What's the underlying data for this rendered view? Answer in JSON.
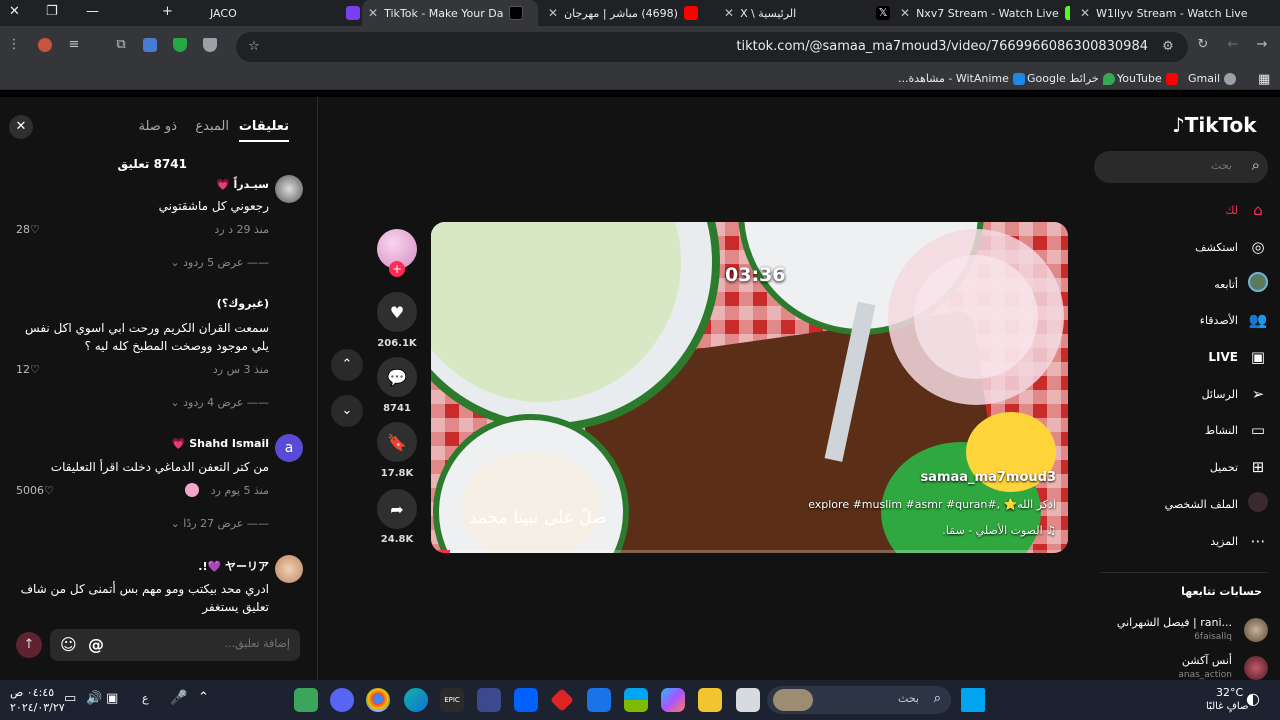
{
  "browser": {
    "tabs": [
      {
        "label": "JACO"
      },
      {
        "label": "TikTok - Make Your Da"
      },
      {
        "label": "(4698) مباشر | مهرجان"
      },
      {
        "label": "الرئيسية \\ X"
      },
      {
        "label": "Nxv7 Stream - Watch Live"
      },
      {
        "label": "W1llyv Stream - Watch Live"
      }
    ],
    "url": "tiktok.com/@samaa_ma7moud3/video/7669966086300830984",
    "bookmarks": [
      {
        "label": "WitAnime - مشاهدة..."
      },
      {
        "label": "خرائط Google"
      },
      {
        "label": "YouTube"
      },
      {
        "label": "Gmail"
      }
    ]
  },
  "comments_panel": {
    "tabs": [
      {
        "label": "تعليقات"
      },
      {
        "label": "المبدع"
      },
      {
        "label": "ذو صلة"
      }
    ],
    "count_label": "8741 تعليق",
    "input_placeholder": "إضافة تعليق...",
    "items": [
      {
        "user": "سيـدراً 💗",
        "text": "رجعوني كل ماشقتوني",
        "meta": "منذ 29 د    رد",
        "likes": "28",
        "replies": "عرض 5 ردود"
      },
      {
        "user": "(غيروك؟)",
        "text": "سمعت القران الكريم ورحت ابي اسوي اكل نفس يلي موجود ووصخت المطبخ كله ليه ؟",
        "meta": "منذ 3 س    رد",
        "likes": "12",
        "replies": "عرض 4 ردود"
      },
      {
        "user": "Shahd Ismail 💗",
        "text": "من كتر التعفن الدماغي دخلت اقرأ التعليقات",
        "meta": "منذ 5 يوم    رد",
        "likes": "5006",
        "replies": "عرض 27 ردًا"
      },
      {
        "user": "ヤーリア 💜!.",
        "text": "ادري محد بيكتب ومو مهم بس أتمنى كل من شاف تعليق يستغفر",
        "meta": "",
        "likes": "",
        "replies": ""
      }
    ],
    "avatar_letter": "a"
  },
  "video": {
    "timer": "03:36",
    "calligraphy": "صلّ على نبينا محمد",
    "author": "samaa_ma7moud3",
    "description": "اذكر الله⭐ ,#explore #muslim #asmr #quran",
    "sound": "♫ الصوت الأصلي - سمَا.",
    "progress": 0.03
  },
  "actions": {
    "likes": "206.1K",
    "comments": "8741",
    "saves": "17.8K",
    "shares": "24.8K"
  },
  "sidebar": {
    "logo": "TikTok",
    "search_placeholder": "بحث",
    "nav": [
      {
        "label": "لك",
        "icon": "home-icon"
      },
      {
        "label": "استكشف",
        "icon": "compass-icon"
      },
      {
        "label": "أتابعه",
        "icon": "following-icon"
      },
      {
        "label": "الأصدقاء",
        "icon": "friends-icon"
      },
      {
        "label": "LIVE",
        "icon": "live-icon"
      },
      {
        "label": "الرسائل",
        "icon": "messages-icon"
      },
      {
        "label": "النشاط",
        "icon": "activity-icon"
      },
      {
        "label": "تحميل",
        "icon": "upload-icon"
      },
      {
        "label": "الملف الشخصي",
        "icon": "profile-icon"
      },
      {
        "label": "المزيد",
        "icon": "more-icon"
      }
    ],
    "following_title": "حسابات تتابعها",
    "following": [
      {
        "name": "فيصل الشهراني | rani...",
        "handle": "6faisallq"
      },
      {
        "name": "أنس آكشن",
        "handle": "anas_action"
      }
    ]
  },
  "taskbar": {
    "search": "بحث",
    "weather_temp": "32°C",
    "weather_text": "صافٍ غالبًا",
    "time": "٠٤:٤٥ ص",
    "date": "٢٠٢٤/٠٣/٢٧",
    "lang": "ع"
  },
  "colors": {
    "accent": "#fe2c55",
    "page_bg": "#121212"
  }
}
